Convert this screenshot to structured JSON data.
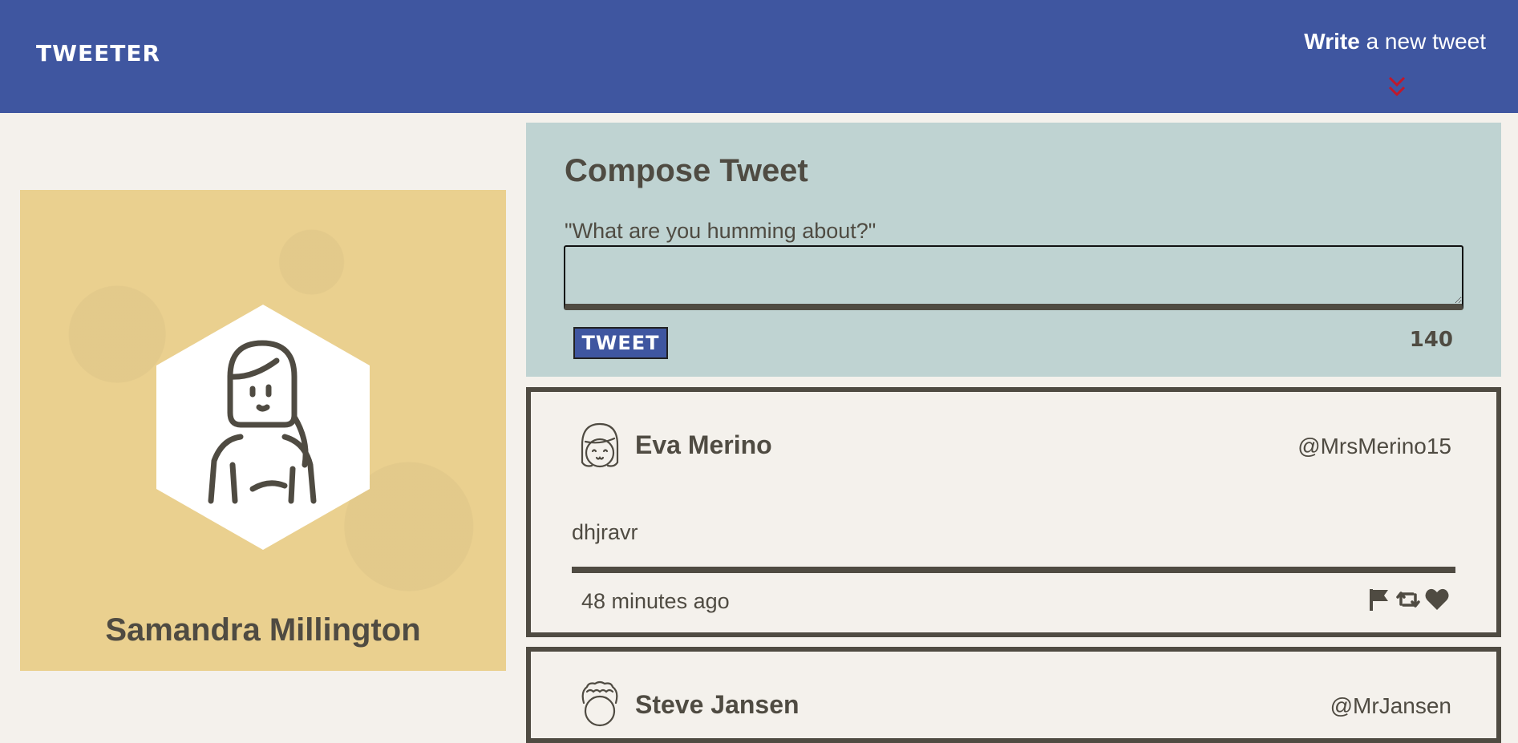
{
  "nav": {
    "brand": "TWEETER",
    "write_bold": "Write",
    "write_rest": " a new tweet"
  },
  "profile": {
    "name": "Samandra Millington"
  },
  "compose": {
    "title": "Compose Tweet",
    "prompt": "\"What are you humming about?\"",
    "textarea_value": "",
    "button_label": "TWEET",
    "counter": "140"
  },
  "tweets": [
    {
      "name": "Eva Merino",
      "handle": "@MrsMerino15",
      "body": "dhjravr",
      "time": "48 minutes ago"
    },
    {
      "name": "Steve Jansen",
      "handle": "@MrJansen"
    }
  ],
  "colors": {
    "nav_bg": "#3f56a0",
    "page_bg": "#f4f1ec",
    "profile_bg": "#ead08f",
    "compose_bg": "#bfd3d2",
    "text": "#4f4b42",
    "accent_red": "#c0182b"
  },
  "icons": {
    "chevrons": "double-chevron-down-icon",
    "flag": "flag-icon",
    "retweet": "retweet-icon",
    "like": "heart-icon"
  }
}
